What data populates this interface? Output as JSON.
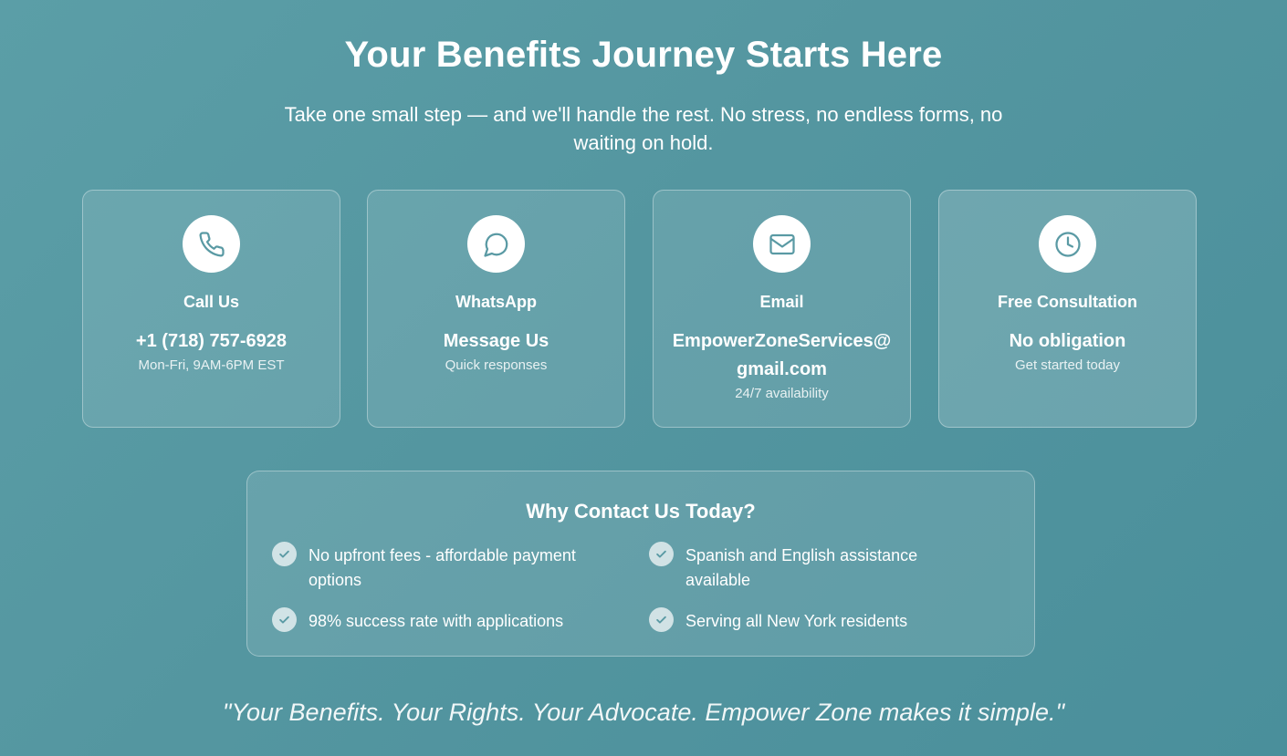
{
  "hero": {
    "title": "Your Benefits Journey Starts Here",
    "subtitle": "Take one small step — and we'll handle the rest. No stress, no endless forms, no waiting on hold."
  },
  "cards": [
    {
      "icon": "phone-icon",
      "label": "Call Us",
      "value": "+1 (718) 757-6928",
      "note": "Mon-Fri, 9AM-6PM EST"
    },
    {
      "icon": "chat-bubble-icon",
      "label": "WhatsApp",
      "value": "Message Us",
      "note": "Quick responses"
    },
    {
      "icon": "mail-icon",
      "label": "Email",
      "value": "EmpowerZoneServices@gmail.com",
      "note": "24/7 availability"
    },
    {
      "icon": "clock-icon",
      "label": "Free Consultation",
      "value": "No obligation",
      "note": "Get started today"
    }
  ],
  "why": {
    "title": "Why Contact Us Today?",
    "items": [
      "No upfront fees - affordable payment options",
      "Spanish and English assistance available",
      "98% success rate with applications",
      "Serving all New York residents"
    ]
  },
  "quote": "\"Your Benefits. Your Rights. Your Advocate. Empower Zone makes it simple.\"",
  "colors": {
    "background": "#5496a0",
    "icon_stroke": "#5a9aa4",
    "text": "#ffffff"
  }
}
